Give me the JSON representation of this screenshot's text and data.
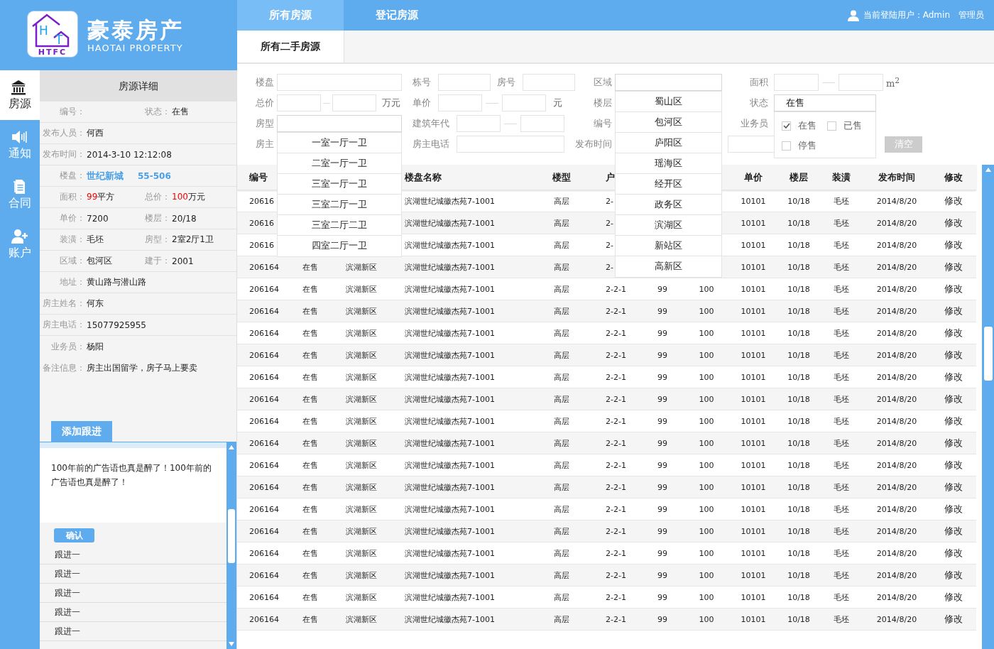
{
  "logo": {
    "letters": [
      "H",
      "T"
    ],
    "caption": "HTFC",
    "name": "豪泰房产",
    "tagline": "HAOTAI PROPERTY"
  },
  "top_tabs": [
    {
      "label": "所有房源",
      "selected": true
    },
    {
      "label": "登记房源",
      "selected": false
    }
  ],
  "user": {
    "text": "当前登陆用户：Admin",
    "role": "管理员"
  },
  "sub_tabs": [
    {
      "label": "所有二手房源",
      "selected": true
    }
  ],
  "nav": [
    {
      "label": "房源",
      "selected": true
    },
    {
      "label": "通知",
      "selected": false
    },
    {
      "label": "合同",
      "selected": false
    },
    {
      "label": "账户",
      "selected": false
    }
  ],
  "details": {
    "title": "房源详细",
    "rows": [
      {
        "items": [
          {
            "label": "编号："
          },
          {
            "label": "状态：",
            "value": "在售"
          }
        ]
      },
      {
        "items": [
          {
            "label": "发布人员：",
            "value": "何西"
          }
        ]
      },
      {
        "items": [
          {
            "label": "发布时间：",
            "value": "2014-3-10 12:12:08"
          }
        ]
      },
      {
        "items": [
          {
            "label": "楼盘：",
            "value": "世纪新城",
            "suffix": "55-506",
            "kind": "building"
          }
        ]
      },
      {
        "items": [
          {
            "label": "面积：",
            "value": "99",
            "suffix": "平方",
            "kind": "figure"
          },
          {
            "label": "总价：",
            "value": "100",
            "suffix": "万元",
            "kind": "figure"
          }
        ]
      },
      {
        "items": [
          {
            "label": "单价：",
            "value": "7200"
          },
          {
            "label": "楼层：",
            "value": "20/18"
          }
        ]
      },
      {
        "items": [
          {
            "label": "装潢：",
            "value": "毛坯"
          },
          {
            "label": "房型：",
            "value": "2室2厅1卫"
          }
        ]
      },
      {
        "items": [
          {
            "label": "区域：",
            "value": "包河区"
          },
          {
            "label": "建于：",
            "value": "2001"
          }
        ]
      },
      {
        "items": [
          {
            "label": "地址：",
            "value": "黄山路与潜山路"
          }
        ]
      },
      {
        "items": [
          {
            "label": "房主姓名：",
            "value": "何东"
          }
        ]
      },
      {
        "items": [
          {
            "label": "房主电话：",
            "value": "15077925955"
          }
        ]
      },
      {
        "items": [
          {
            "label": "业务员：",
            "value": "杨阳"
          }
        ]
      },
      {
        "items": [
          {
            "label": "备注信息：",
            "value": "房主出国留学，房子马上要卖"
          }
        ]
      }
    ]
  },
  "follow_up": {
    "tab": "添加跟进",
    "text": "100年前的广告语也真是醉了！100年前的广告语也真是醉了！",
    "confirm": "确认",
    "entries": [
      "跟进一",
      "跟进一",
      "跟进一",
      "跟进一",
      "跟进一"
    ]
  },
  "filters": {
    "rows": [
      [
        {
          "fields": [
            {
              "label": "楼盘",
              "kind": "text"
            }
          ]
        },
        {
          "fields": [
            {
              "label": "栋号",
              "kind": "short"
            },
            {
              "label": "房号",
              "kind": "short"
            }
          ]
        },
        {
          "fields": [
            {
              "label": "区域",
              "kind": "select",
              "expanded": true,
              "options": [
                "蜀山区",
                "包河区",
                "庐阳区",
                "瑶海区",
                "经开区",
                "政务区",
                "滨湖区",
                "新站区",
                "高新区"
              ]
            }
          ]
        },
        {
          "fields": [
            {
              "label": "面积",
              "kind": "range",
              "unit": "m$^{2}$"
            }
          ]
        }
      ],
      [
        {
          "fields": [
            {
              "label": "总价",
              "kind": "range",
              "unit": "万元"
            }
          ]
        },
        {
          "fields": [
            {
              "label": "单价",
              "kind": "range",
              "unit": "元"
            }
          ]
        },
        {
          "fields": [
            {
              "label": "楼层",
              "kind": "select",
              "expanded": false
            }
          ]
        },
        {
          "fields": [
            {
              "label": "状态",
              "kind": "checklist",
              "value": "在售",
              "expanded": true,
              "options": [
                {
                  "label": "在售",
                  "checked": true
                },
                {
                  "label": "已售",
                  "checked": false
                },
                {
                  "label": "停售",
                  "checked": false
                }
              ]
            }
          ]
        }
      ],
      [
        {
          "fields": [
            {
              "label": "房型",
              "kind": "select",
              "expanded": true,
              "options": [
                "一室一厅一卫",
                "二室一厅一卫",
                "三室一厅一卫",
                "三室二厅一卫",
                "三室二厅二卫",
                "四室二厅一卫"
              ]
            }
          ]
        },
        {
          "fields": [
            {
              "label": "建筑年代",
              "kind": "range"
            }
          ]
        },
        {
          "fields": [
            {
              "label": "编号",
              "kind": "text"
            }
          ]
        },
        {
          "fields": [
            {
              "label": "业务员",
              "kind": "text"
            }
          ]
        }
      ],
      [
        {
          "fields": [
            {
              "label": "房主",
              "kind": "text"
            }
          ]
        },
        {
          "fields": [
            {
              "label": "房主电话",
              "kind": "text"
            }
          ]
        },
        {
          "fields": [
            {
              "label": "发布时间",
              "kind": "text"
            }
          ]
        },
        {
          "fields": [
            {
              "kind": "text"
            },
            {
              "kind": "button",
              "label": "清空"
            }
          ]
        }
      ]
    ]
  },
  "table": {
    "columns": [
      "编号",
      null,
      null,
      "楼盘名称",
      "楼型",
      "户",
      null,
      null,
      "单价",
      "楼层",
      "装潢",
      "发布时间",
      "修改"
    ],
    "rows": [
      [
        "20616",
        null,
        null,
        "滨湖世纪城徽杰苑7-1001",
        "高层",
        "2-",
        null,
        null,
        "10101",
        "10/18",
        "毛坯",
        "2014/8/20",
        "修改"
      ],
      [
        "20616",
        null,
        null,
        "滨湖世纪城徽杰苑7-1001",
        "高层",
        "2-",
        null,
        null,
        "10101",
        "10/18",
        "毛坯",
        "2014/8/20",
        "修改"
      ],
      [
        "20616",
        null,
        null,
        "滨湖世纪城徽杰苑7-1001",
        "高层",
        "2-",
        null,
        null,
        "10101",
        "10/18",
        "毛坯",
        "2014/8/20",
        "修改"
      ],
      [
        "206164",
        "在售",
        "滨湖新区",
        "滨湖世纪城徽杰苑7-1001",
        "高层",
        "2-",
        null,
        null,
        "10101",
        "10/18",
        "毛坯",
        "2014/8/20",
        "修改"
      ],
      [
        "206164",
        "在售",
        "滨湖新区",
        "滨湖世纪城徽杰苑7-1001",
        "高层",
        "2-2-1",
        "99",
        "100",
        "10101",
        "10/18",
        "毛坯",
        "2014/8/20",
        "修改"
      ],
      [
        "206164",
        "在售",
        "滨湖新区",
        "滨湖世纪城徽杰苑7-1001",
        "高层",
        "2-2-1",
        "99",
        "100",
        "10101",
        "10/18",
        "毛坯",
        "2014/8/20",
        "修改"
      ],
      [
        "206164",
        "在售",
        "滨湖新区",
        "滨湖世纪城徽杰苑7-1001",
        "高层",
        "2-2-1",
        "99",
        "100",
        "10101",
        "10/18",
        "毛坯",
        "2014/8/20",
        "修改"
      ],
      [
        "206164",
        "在售",
        "滨湖新区",
        "滨湖世纪城徽杰苑7-1001",
        "高层",
        "2-2-1",
        "99",
        "100",
        "10101",
        "10/18",
        "毛坯",
        "2014/8/20",
        "修改"
      ],
      [
        "206164",
        "在售",
        "滨湖新区",
        "滨湖世纪城徽杰苑7-1001",
        "高层",
        "2-2-1",
        "99",
        "100",
        "10101",
        "10/18",
        "毛坯",
        "2014/8/20",
        "修改"
      ],
      [
        "206164",
        "在售",
        "滨湖新区",
        "滨湖世纪城徽杰苑7-1001",
        "高层",
        "2-2-1",
        "99",
        "100",
        "10101",
        "10/18",
        "毛坯",
        "2014/8/20",
        "修改"
      ],
      [
        "206164",
        "在售",
        "滨湖新区",
        "滨湖世纪城徽杰苑7-1001",
        "高层",
        "2-2-1",
        "99",
        "100",
        "10101",
        "10/18",
        "毛坯",
        "2014/8/20",
        "修改"
      ],
      [
        "206164",
        "在售",
        "滨湖新区",
        "滨湖世纪城徽杰苑7-1001",
        "高层",
        "2-2-1",
        "99",
        "100",
        "10101",
        "10/18",
        "毛坯",
        "2014/8/20",
        "修改"
      ],
      [
        "206164",
        "在售",
        "滨湖新区",
        "滨湖世纪城徽杰苑7-1001",
        "高层",
        "2-2-1",
        "99",
        "100",
        "10101",
        "10/18",
        "毛坯",
        "2014/8/20",
        "修改"
      ],
      [
        "206164",
        "在售",
        "滨湖新区",
        "滨湖世纪城徽杰苑7-1001",
        "高层",
        "2-2-1",
        "99",
        "100",
        "10101",
        "10/18",
        "毛坯",
        "2014/8/20",
        "修改"
      ],
      [
        "206164",
        "在售",
        "滨湖新区",
        "滨湖世纪城徽杰苑7-1001",
        "高层",
        "2-2-1",
        "99",
        "100",
        "10101",
        "10/18",
        "毛坯",
        "2014/8/20",
        "修改"
      ],
      [
        "206164",
        "在售",
        "滨湖新区",
        "滨湖世纪城徽杰苑7-1001",
        "高层",
        "2-2-1",
        "99",
        "100",
        "10101",
        "10/18",
        "毛坯",
        "2014/8/20",
        "修改"
      ],
      [
        "206164",
        "在售",
        "滨湖新区",
        "滨湖世纪城徽杰苑7-1001",
        "高层",
        "2-2-1",
        "99",
        "100",
        "10101",
        "10/18",
        "毛坯",
        "2014/8/20",
        "修改"
      ],
      [
        "206164",
        "在售",
        "滨湖新区",
        "滨湖世纪城徽杰苑7-1001",
        "高层",
        "2-2-1",
        "99",
        "100",
        "10101",
        "10/18",
        "毛坯",
        "2014/8/20",
        "修改"
      ],
      [
        "206164",
        "在售",
        "滨湖新区",
        "滨湖世纪城徽杰苑7-1001",
        "高层",
        "2-2-1",
        "99",
        "100",
        "10101",
        "10/18",
        "毛坯",
        "2014/8/20",
        "修改"
      ],
      [
        "206164",
        "在售",
        "滨湖新区",
        "滨湖世纪城徽杰苑7-1001",
        "高层",
        "2-2-1",
        "99",
        "100",
        "10101",
        "10/18",
        "毛坯",
        "2014/8/20",
        "修改"
      ]
    ]
  }
}
